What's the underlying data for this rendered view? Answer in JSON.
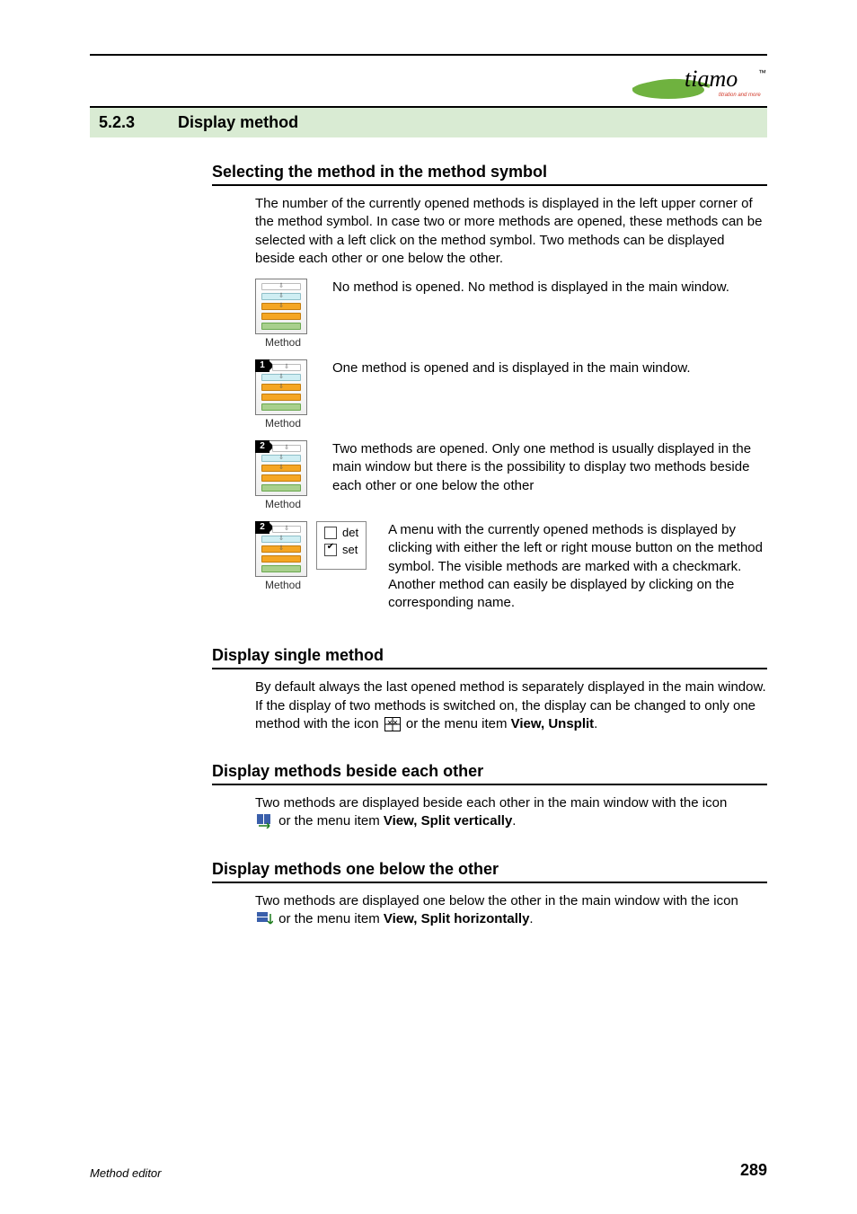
{
  "section": {
    "number": "5.2.3",
    "title": "Display method"
  },
  "logo": {
    "brand": "tiamo",
    "tagline": "titration and more",
    "tm": "™"
  },
  "sub1": {
    "title": "Selecting the method in the method symbol",
    "intro": "The number of the currently opened methods is displayed in the left upper corner of the method symbol. In case two or more methods are opened, these methods can be selected with a left click on the method symbol. Two methods can be displayed beside each other or one below the other."
  },
  "rows": [
    {
      "badge": "",
      "caption": "Method",
      "text": "No method is opened. No method is displayed in the main window."
    },
    {
      "badge": "1",
      "caption": "Method",
      "text": "One method is opened and is displayed in the main window."
    },
    {
      "badge": "2",
      "caption": "Method",
      "text": "Two methods are opened. Only one method is usually displayed in the main window but there is the possibility to display two methods beside each other or one below the other"
    },
    {
      "badge": "2",
      "caption": "Method",
      "menu": {
        "opt1": "det",
        "opt1_checked": false,
        "opt2": "set",
        "opt2_checked": true
      },
      "text": "A menu with the currently opened methods is displayed by clicking with either the left or right mouse button on the method symbol. The visible methods are marked with a checkmark. Another method can easily be displayed by clicking on the corresponding name."
    }
  ],
  "sub2": {
    "title": "Display single method",
    "text_a": "By default always the last opened method is separately displayed in the main window. If the display of two methods is switched on, the display can be changed to only one method with the icon ",
    "text_b": " or the menu item ",
    "menu": "View, Unsplit",
    "period": "."
  },
  "sub3": {
    "title": "Display methods beside each other",
    "text_a": "Two methods are displayed beside each other in the main window with the icon ",
    "text_b": " or the menu item ",
    "menu": "View, Split vertically",
    "period": "."
  },
  "sub4": {
    "title": "Display methods one below the other",
    "text_a": "Two methods are displayed one below the other in the main window with the icon ",
    "text_b": " or the menu item ",
    "menu": "View, Split horizontally",
    "period": "."
  },
  "footer": {
    "left": "Method editor",
    "right": "289"
  }
}
